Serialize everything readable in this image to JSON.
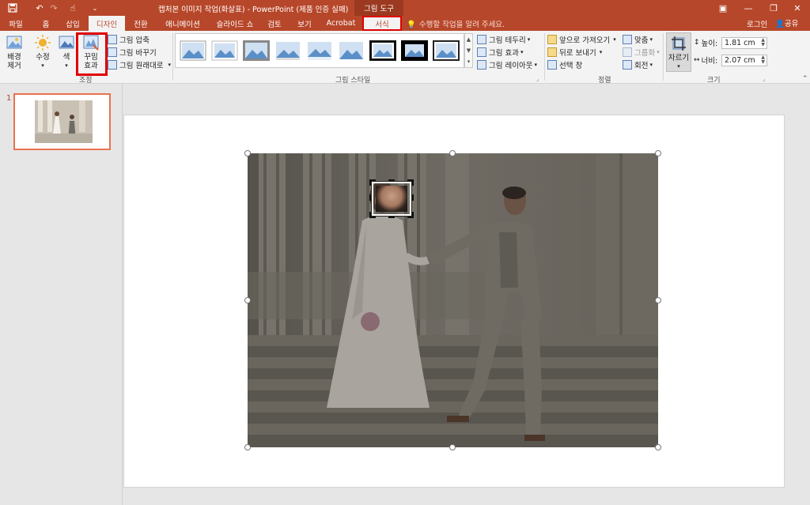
{
  "quick_access": {
    "save_icon": "save-icon",
    "undo_icon": "undo-icon",
    "redo_icon": "redo-icon",
    "touch_icon": "touch-mode-icon",
    "customize_icon": "customize-icon"
  },
  "titlebar": {
    "title": "캡처본 이미지 작업(화살표) - PowerPoint (제품 인증 실패)",
    "context_tool": "그림 도구"
  },
  "window_controls": {
    "ribbon_display": "▣",
    "minimize": "—",
    "maximize": "❐",
    "close": "✕"
  },
  "tabs": [
    {
      "label": "파일"
    },
    {
      "label": "홈"
    },
    {
      "label": "삽입"
    },
    {
      "label": "디자인"
    },
    {
      "label": "전환"
    },
    {
      "label": "애니메이션"
    },
    {
      "label": "슬라이드 쇼"
    },
    {
      "label": "검토"
    },
    {
      "label": "보기"
    },
    {
      "label": "Acrobat"
    },
    {
      "label": "서식"
    }
  ],
  "tell_me": "수행할 작업을 알려 주세요.",
  "account": {
    "login": "로그인",
    "share": "공유"
  },
  "ribbon": {
    "adjust": {
      "remove_bg": "배경\n제거",
      "corrections": "수정",
      "color": "색",
      "artistic": "꾸밈\n효과",
      "compress": "그림 압축",
      "change": "그림 바꾸기",
      "reset": "그림 원래대로",
      "group_label": "조정"
    },
    "styles": {
      "border": "그림 테두리",
      "effects": "그림 효과",
      "layout": "그림 레이아웃",
      "group_label": "그림 스타일"
    },
    "arrange": {
      "bring_forward": "앞으로 가져오기",
      "send_backward": "뒤로 보내기",
      "selection_pane": "선택 창",
      "align": "맞춤",
      "group": "그룹화",
      "rotate": "회전",
      "group_label": "정렬"
    },
    "size": {
      "crop": "자르기",
      "height_label": "높이:",
      "height_value": "1.81 cm",
      "width_label": "너비:",
      "width_value": "2.07 cm",
      "group_label": "크기"
    }
  },
  "slides_pane": {
    "slide_number": "1"
  },
  "colors": {
    "accent": "#b7472a",
    "highlight_box": "#e00000"
  }
}
